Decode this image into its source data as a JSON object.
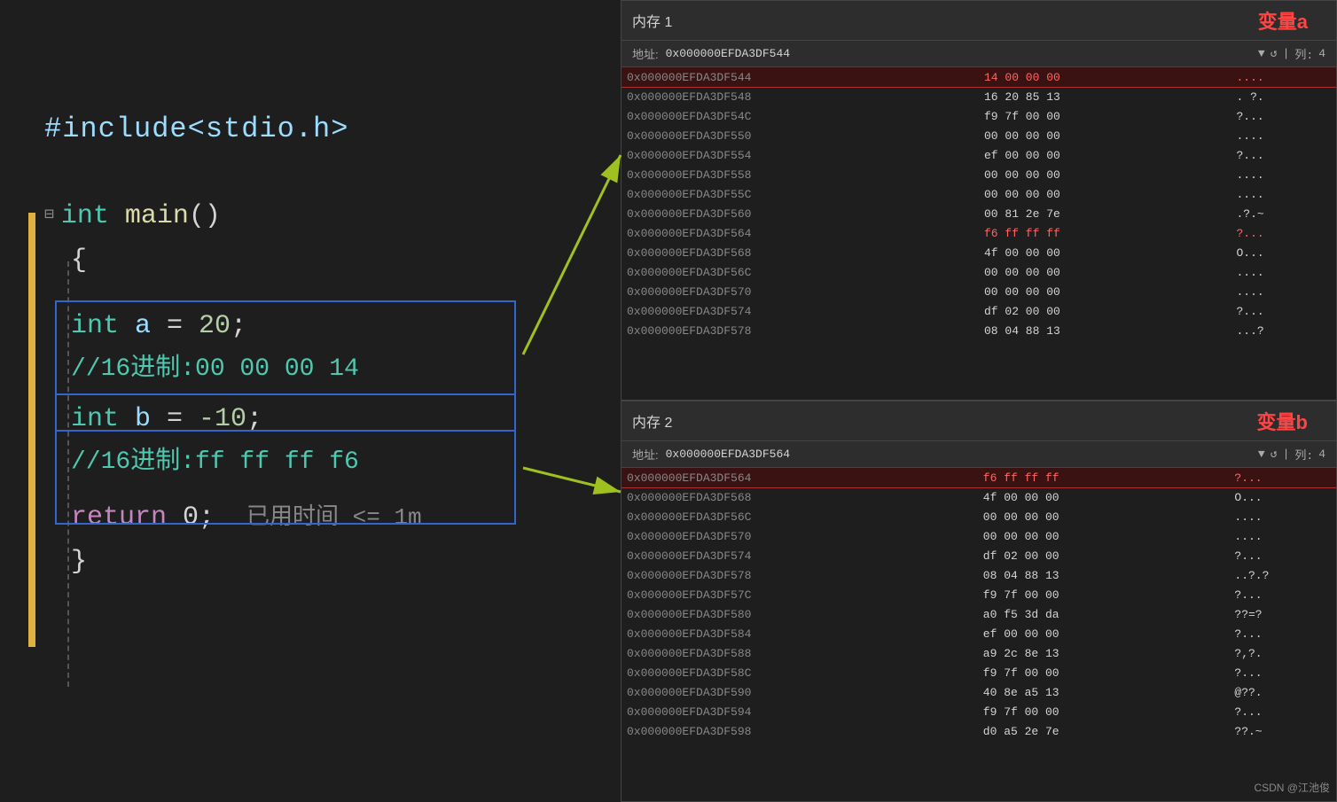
{
  "code_panel": {
    "include_line": "#include<stdio.h>",
    "main_func": "int main()",
    "brace_open": "{",
    "int_a_line": "    int a = 20;",
    "comment_a": "//16进制:00 00 00 14",
    "int_b_line": "    int b = -10;",
    "comment_b": "//16进制:ff ff ff f6",
    "return_line": "    return 0;",
    "return_suffix": "  已用时间 <= 1m",
    "brace_close": "}"
  },
  "memory1": {
    "title": "内存 1",
    "label": "变量a",
    "address_label": "地址:",
    "address_value": "0x000000EFDA3DF544",
    "col_label": "列:",
    "col_value": "4",
    "rows": [
      {
        "addr": "0x000000EFDA3DF544",
        "bytes": "14 00 00 00",
        "chars": "....",
        "highlighted": true
      },
      {
        "addr": "0x000000EFDA3DF548",
        "bytes": "16 20 85 13",
        "chars": ". ?.",
        "highlighted": false
      },
      {
        "addr": "0x000000EFDA3DF54C",
        "bytes": "f9 7f 00 00",
        "chars": "?...",
        "highlighted": false
      },
      {
        "addr": "0x000000EFDA3DF550",
        "bytes": "00 00 00 00",
        "chars": "....",
        "highlighted": false
      },
      {
        "addr": "0x000000EFDA3DF554",
        "bytes": "ef 00 00 00",
        "chars": "?...",
        "highlighted": false
      },
      {
        "addr": "0x000000EFDA3DF558",
        "bytes": "00 00 00 00",
        "chars": "....",
        "highlighted": false
      },
      {
        "addr": "0x000000EFDA3DF55C",
        "bytes": "00 00 00 00",
        "chars": "....",
        "highlighted": false
      },
      {
        "addr": "0x000000EFDA3DF560",
        "bytes": "00 81 2e 7e",
        "chars": ".?.~",
        "highlighted": false
      },
      {
        "addr": "0x000000EFDA3DF564",
        "bytes": "f6 ff ff ff",
        "chars": "?...",
        "highlighted": false,
        "bytes_red": true
      },
      {
        "addr": "0x000000EFDA3DF568",
        "bytes": "4f 00 00 00",
        "chars": "O...",
        "highlighted": false
      },
      {
        "addr": "0x000000EFDA3DF56C",
        "bytes": "00 00 00 00",
        "chars": "....",
        "highlighted": false
      },
      {
        "addr": "0x000000EFDA3DF570",
        "bytes": "00 00 00 00",
        "chars": "....",
        "highlighted": false
      },
      {
        "addr": "0x000000EFDA3DF574",
        "bytes": "df 02 00 00",
        "chars": "?...",
        "highlighted": false
      },
      {
        "addr": "0x000000EFDA3DF578",
        "bytes": "08 04 88 13",
        "chars": "...?",
        "highlighted": false
      }
    ]
  },
  "memory2": {
    "title": "内存 2",
    "label": "变量b",
    "address_label": "地址:",
    "address_value": "0x000000EFDA3DF564",
    "col_label": "列:",
    "col_value": "4",
    "rows": [
      {
        "addr": "0x000000EFDA3DF564",
        "bytes": "f6 ff ff ff",
        "chars": "?...",
        "highlighted": true
      },
      {
        "addr": "0x000000EFDA3DF568",
        "bytes": "4f 00 00 00",
        "chars": "O...",
        "highlighted": false
      },
      {
        "addr": "0x000000EFDA3DF56C",
        "bytes": "00 00 00 00",
        "chars": "....",
        "highlighted": false
      },
      {
        "addr": "0x000000EFDA3DF570",
        "bytes": "00 00 00 00",
        "chars": "....",
        "highlighted": false
      },
      {
        "addr": "0x000000EFDA3DF574",
        "bytes": "df 02 00 00",
        "chars": "?...",
        "highlighted": false
      },
      {
        "addr": "0x000000EFDA3DF578",
        "bytes": "08 04 88 13",
        "chars": "..?.?",
        "highlighted": false
      },
      {
        "addr": "0x000000EFDA3DF57C",
        "bytes": "f9 7f 00 00",
        "chars": "?...",
        "highlighted": false
      },
      {
        "addr": "0x000000EFDA3DF580",
        "bytes": "a0 f5 3d da",
        "chars": "??=?",
        "highlighted": false
      },
      {
        "addr": "0x000000EFDA3DF584",
        "bytes": "ef 00 00 00",
        "chars": "?...",
        "highlighted": false
      },
      {
        "addr": "0x000000EFDA3DF588",
        "bytes": "a9 2c 8e 13",
        "chars": "?,?.",
        "highlighted": false
      },
      {
        "addr": "0x000000EFDA3DF58C",
        "bytes": "f9 7f 00 00",
        "chars": "?...",
        "highlighted": false
      },
      {
        "addr": "0x000000EFDA3DF590",
        "bytes": "40 8e a5 13",
        "chars": "@??.",
        "highlighted": false
      },
      {
        "addr": "0x000000EFDA3DF594",
        "bytes": "f9 7f 00 00",
        "chars": "?...",
        "highlighted": false
      },
      {
        "addr": "0x000000EFDA3DF598",
        "bytes": "d0 a5 2e 7e",
        "chars": "??.~",
        "highlighted": false
      }
    ]
  },
  "watermark": "CSDN @江池俊"
}
